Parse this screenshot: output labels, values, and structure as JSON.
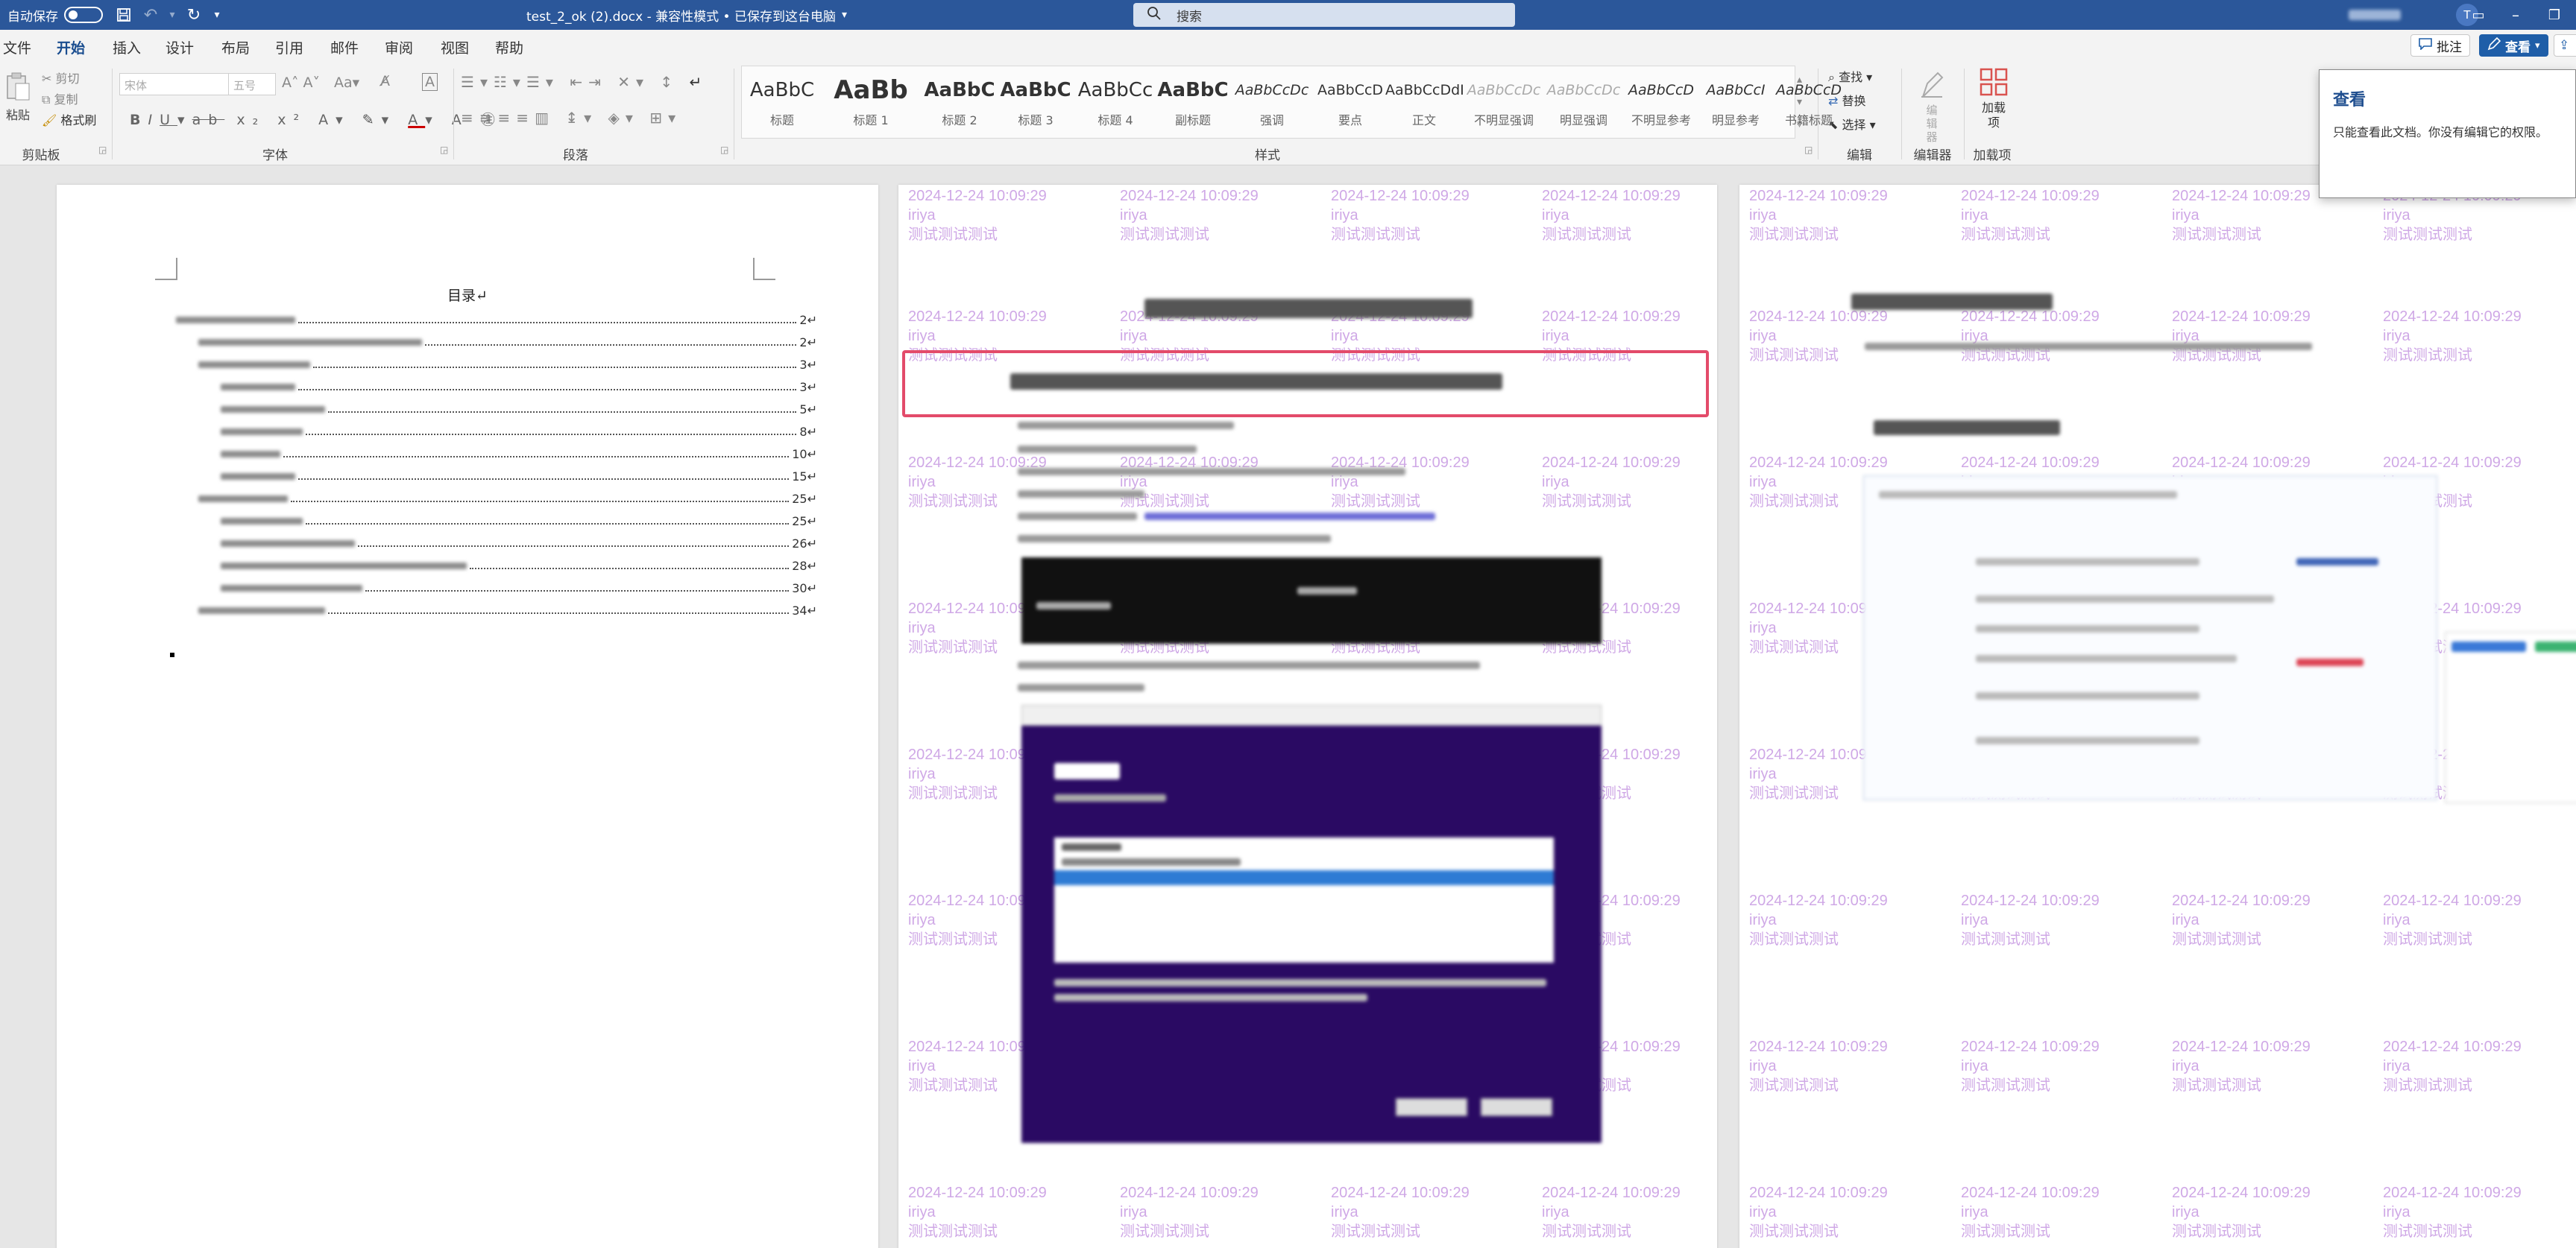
{
  "titlebar": {
    "autosave_label": "自动保存",
    "autosave_state": "关",
    "doc_title": "test_2_ok (2).docx - 兼容性模式 • 已保存到这台电脑",
    "search_placeholder": "搜索",
    "user_initial": "T"
  },
  "tabs": [
    "文件",
    "开始",
    "插入",
    "设计",
    "布局",
    "引用",
    "邮件",
    "审阅",
    "视图",
    "帮助"
  ],
  "header_buttons": {
    "comments": "批注",
    "view_mode": "查看"
  },
  "ribbon": {
    "clipboard": {
      "label": "剪贴板",
      "paste": "粘贴",
      "cut": "剪切",
      "copy": "复制",
      "format_painter": "格式刷"
    },
    "font": {
      "label": "字体",
      "font_name": "宋体",
      "font_size": "五号"
    },
    "paragraph": {
      "label": "段落"
    },
    "styles": {
      "label": "样式",
      "items": [
        {
          "preview": "AaBbC",
          "name": "标题"
        },
        {
          "preview": "AaBb",
          "name": "标题 1"
        },
        {
          "preview": "AaBbC",
          "name": "标题 2"
        },
        {
          "preview": "AaBbC",
          "name": "标题 3"
        },
        {
          "preview": "AaBbCc",
          "name": "标题 4"
        },
        {
          "preview": "AaBbC",
          "name": "副标题"
        },
        {
          "preview": "AaBbCcDc",
          "name": "强调"
        },
        {
          "preview": "AaBbCcD",
          "name": "要点"
        },
        {
          "preview": "AaBbCcDdI",
          "name": "正文"
        },
        {
          "preview": "AaBbCcDc",
          "name": "不明显强调"
        },
        {
          "preview": "AaBbCcDc",
          "name": "明显强调"
        },
        {
          "preview": "AaBbCcD",
          "name": "不明显参考"
        },
        {
          "preview": "AaBbCcI",
          "name": "明显参考"
        },
        {
          "preview": "AaBbCcD",
          "name": "书籍标题"
        }
      ]
    },
    "editing": {
      "label": "编辑",
      "find": "查找",
      "replace": "替换",
      "select": "选择"
    },
    "editor": {
      "label": "编辑器",
      "button": "编辑器"
    },
    "addins": {
      "label": "加载项",
      "button": "加载项"
    }
  },
  "tooltip": {
    "title": "查看",
    "body": "只能查看此文档。你没有编辑它的权限。"
  },
  "document": {
    "toc_title": "目录",
    "toc_pages": [
      "2",
      "2",
      "3",
      "3",
      "5",
      "8",
      "10",
      "15",
      "25",
      "25",
      "26",
      "28",
      "30",
      "34"
    ],
    "watermark": {
      "date": "2024-12-24 10:09:29",
      "user": "iriya",
      "text": "测试测试测试"
    }
  },
  "colors": {
    "titlebar": "#2b579a",
    "watermark": "#cfa8e6",
    "highlight_box": "#e34b6a",
    "installer_bg": "#2a0a63"
  }
}
